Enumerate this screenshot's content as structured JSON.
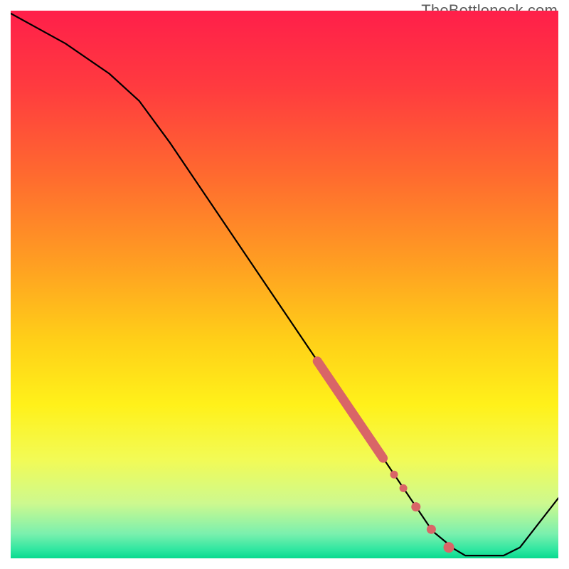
{
  "watermark": "TheBottleneck.com",
  "chart_data": {
    "type": "line",
    "title": "",
    "xlabel": "",
    "ylabel": "",
    "x_range_norm": [
      0,
      1
    ],
    "y_range_norm": [
      0,
      1
    ],
    "curve_points_norm": [
      {
        "x": 0.0,
        "y": 0.995
      },
      {
        "x": 0.1,
        "y": 0.94
      },
      {
        "x": 0.18,
        "y": 0.885
      },
      {
        "x": 0.235,
        "y": 0.835
      },
      {
        "x": 0.29,
        "y": 0.76
      },
      {
        "x": 0.77,
        "y": 0.05
      },
      {
        "x": 0.81,
        "y": 0.017
      },
      {
        "x": 0.83,
        "y": 0.005
      },
      {
        "x": 0.9,
        "y": 0.005
      },
      {
        "x": 0.93,
        "y": 0.02
      },
      {
        "x": 1.0,
        "y": 0.11
      }
    ],
    "highlight_segment_norm": [
      {
        "x": 0.56,
        "y": 0.36
      },
      {
        "x": 0.68,
        "y": 0.183
      }
    ],
    "highlight_dots_norm": [
      {
        "x": 0.7,
        "y": 0.153
      },
      {
        "x": 0.717,
        "y": 0.128
      },
      {
        "x": 0.74,
        "y": 0.094
      },
      {
        "x": 0.768,
        "y": 0.053
      },
      {
        "x": 0.8,
        "y": 0.02
      }
    ],
    "gradient_stops": [
      {
        "offset": 0.0,
        "color": "#ff1f4a"
      },
      {
        "offset": 0.14,
        "color": "#ff3b3f"
      },
      {
        "offset": 0.3,
        "color": "#ff6a2f"
      },
      {
        "offset": 0.46,
        "color": "#ff9e22"
      },
      {
        "offset": 0.6,
        "color": "#ffcf18"
      },
      {
        "offset": 0.72,
        "color": "#fff11a"
      },
      {
        "offset": 0.82,
        "color": "#f2fb56"
      },
      {
        "offset": 0.9,
        "color": "#cdf98f"
      },
      {
        "offset": 0.955,
        "color": "#7bf0ae"
      },
      {
        "offset": 0.985,
        "color": "#2de6a0"
      },
      {
        "offset": 1.0,
        "color": "#08da8f"
      }
    ],
    "highlight_color": "#d96567",
    "curve_color": "#000000"
  }
}
